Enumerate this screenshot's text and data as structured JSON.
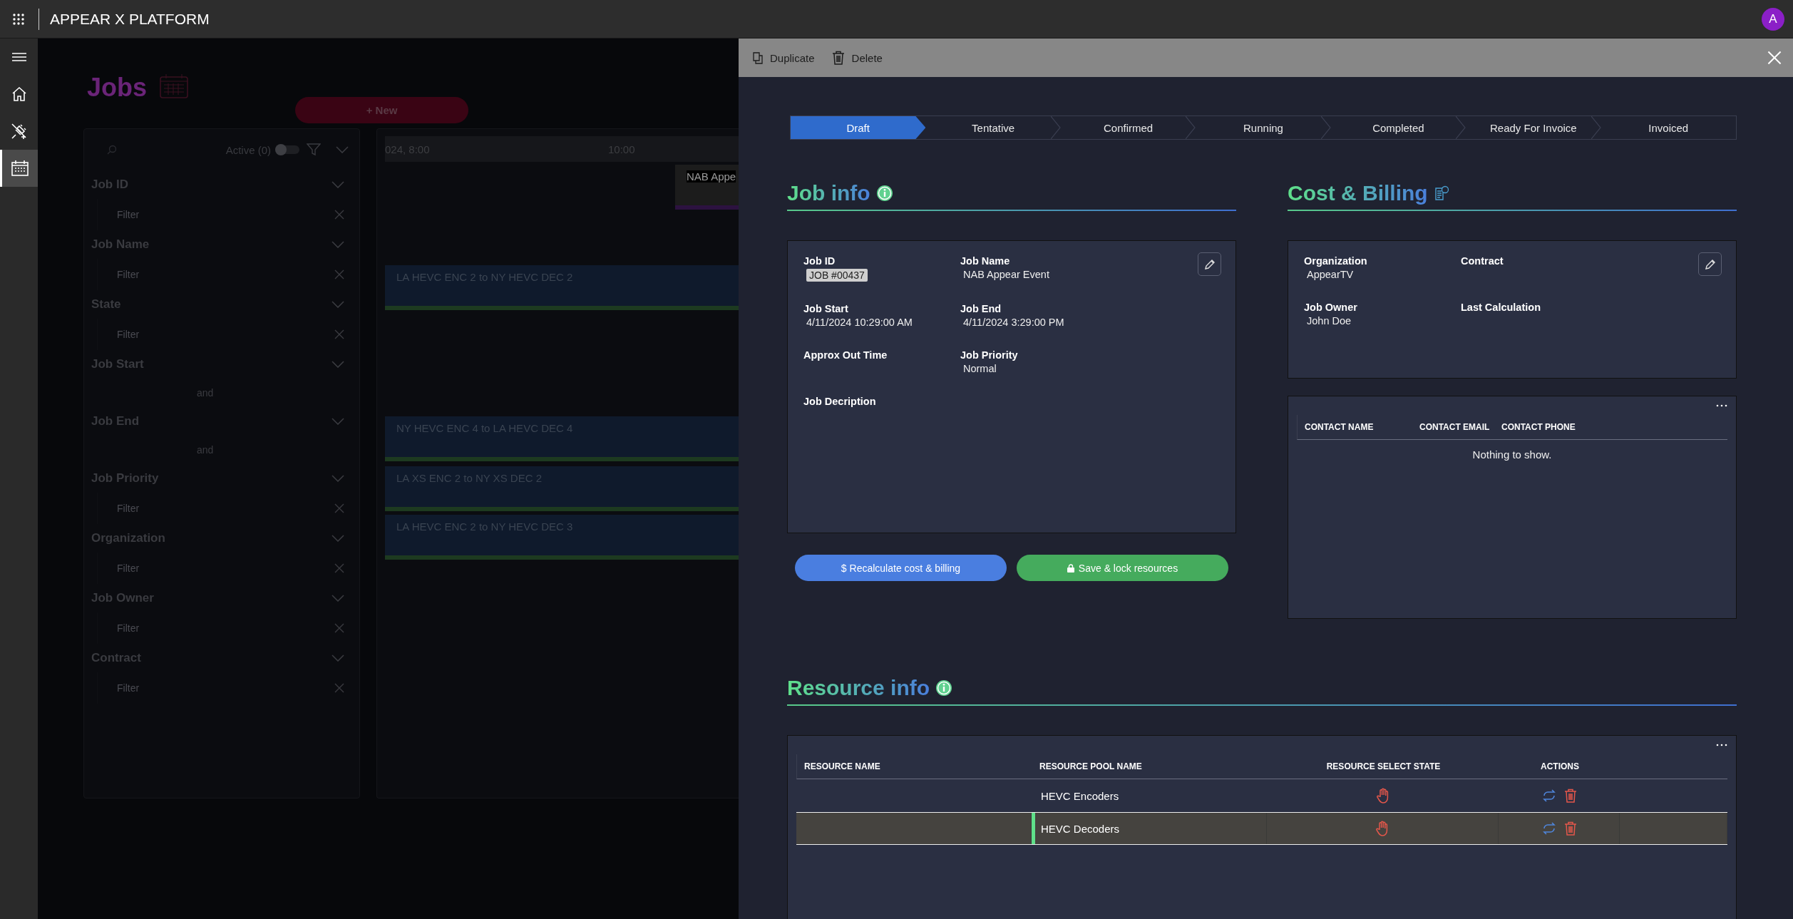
{
  "app": {
    "title": "APPEAR X PLATFORM",
    "avatar": "A"
  },
  "nav": [
    {
      "kind": "menu",
      "selected": false
    },
    {
      "kind": "home",
      "selected": false
    },
    {
      "kind": "plug",
      "selected": false
    },
    {
      "kind": "calendar",
      "selected": true
    }
  ],
  "jobs_page": {
    "title": "Jobs",
    "new_button": "+ New",
    "active_toggle": {
      "label": "Active (0)",
      "on": false
    },
    "filters": [
      {
        "label": "Job ID",
        "kind": "text",
        "placeholder": "Filter"
      },
      {
        "label": "Job Name",
        "kind": "text",
        "placeholder": "Filter"
      },
      {
        "label": "State",
        "kind": "text",
        "placeholder": "Filter"
      },
      {
        "label": "Job Start",
        "kind": "range",
        "joiner": "and"
      },
      {
        "label": "Job End",
        "kind": "range",
        "joiner": "and"
      },
      {
        "label": "Job Priority",
        "kind": "text",
        "placeholder": "Filter"
      },
      {
        "label": "Organization",
        "kind": "text",
        "placeholder": "Filter"
      },
      {
        "label": "Job Owner",
        "kind": "text",
        "placeholder": "Filter"
      },
      {
        "label": "Contract",
        "kind": "text",
        "placeholder": "Filter"
      }
    ],
    "timeline": {
      "ticks": [
        "024, 8:00",
        "10:00"
      ],
      "events": [
        {
          "label": "NAB Appe",
          "kind": "job",
          "color": "#2c1240"
        },
        {
          "label": "LA HEVC ENC 2 to NY HEVC DEC 2",
          "kind": "link",
          "color": "#1d3a20"
        },
        {
          "label": "NY HEVC ENC 4 to LA HEVC DEC 4",
          "kind": "link",
          "color": "#1d3a20"
        },
        {
          "label": "LA XS ENC 2 to NY XS DEC 2",
          "kind": "link",
          "color": "#1d3a20"
        },
        {
          "label": "LA HEVC ENC 2 to NY HEVC DEC 3",
          "kind": "link",
          "color": "#1d3a20"
        }
      ]
    }
  },
  "panel": {
    "actions": [
      {
        "label": "Duplicate",
        "kind": "duplicate"
      },
      {
        "label": "Delete",
        "kind": "delete"
      }
    ],
    "stages": [
      {
        "label": "Draft",
        "selected": true
      },
      {
        "label": "Tentative",
        "selected": false
      },
      {
        "label": "Confirmed",
        "selected": false
      },
      {
        "label": "Running",
        "selected": false
      },
      {
        "label": "Completed",
        "selected": false
      },
      {
        "label": "Ready For Invoice",
        "selected": false
      },
      {
        "label": "Invoiced",
        "selected": false
      }
    ],
    "job_info": {
      "title": "Job info",
      "fields": [
        {
          "label": "Job ID",
          "value": "JOB #00437",
          "kind": "badge"
        },
        {
          "label": "Job Name",
          "value": "NAB Appear Event",
          "kind": "text"
        },
        {
          "label": "Job Start",
          "value": "4/11/2024 10:29:00 AM",
          "kind": "text"
        },
        {
          "label": "Job End",
          "value": "4/11/2024 3:29:00 PM",
          "kind": "text"
        },
        {
          "label": "Approx Out Time"
        },
        {
          "label": "Job Priority",
          "value": "Normal",
          "kind": "text"
        },
        {
          "label": "Job Decription"
        }
      ]
    },
    "buttons": [
      {
        "label": "$ Recalculate cost & billing",
        "kind": "recalculate"
      },
      {
        "label": "Save & lock resources",
        "kind": "save"
      }
    ],
    "cost_billing": {
      "title": "Cost & Billing",
      "fields": [
        {
          "label": "Organization",
          "value": "AppearTV"
        },
        {
          "label": "Contract"
        },
        {
          "label": "Job Owner",
          "value": "John Doe"
        },
        {
          "label": "Last Calculation"
        }
      ]
    },
    "contacts": {
      "columns": [
        "CONTACT NAME",
        "CONTACT EMAIL",
        "CONTACT PHONE"
      ],
      "empty": "Nothing to show."
    },
    "resource_info": {
      "title": "Resource info",
      "columns": [
        "RESOURCE NAME",
        "RESOURCE POOL NAME",
        "RESOURCE SELECT STATE",
        "ACTIONS"
      ],
      "rows": [
        {
          "pool": "HEVC Encoders",
          "selected": false
        },
        {
          "pool": "HEVC Decoders",
          "selected": true
        }
      ]
    }
  }
}
